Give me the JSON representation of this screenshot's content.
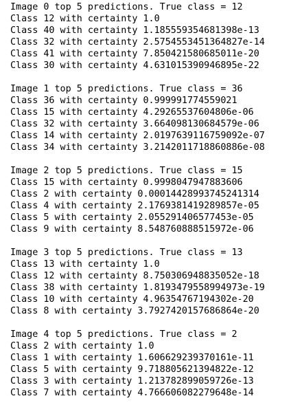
{
  "blocks": [
    {
      "header": "Image 0 top 5 predictions. True class = 12",
      "lines": [
        "Class 12 with certainty 1.0",
        "Class 40 with certainty 1.185559354681398e-13",
        "Class 32 with certainty 2.5754553451364827e-14",
        "Class 41 with certainty 7.850421580685011e-20",
        "Class 30 with certainty 4.631015390946895e-22"
      ]
    },
    {
      "header": "Image 1 top 5 predictions. True class = 36",
      "lines": [
        "Class 36 with certainty 0.999991774559021",
        "Class 15 with certainty 4.29265537604806e-06",
        "Class 32 with certainty 3.664098130684579e-06",
        "Class 14 with certainty 2.0197639116759092e-07",
        "Class 34 with certainty 3.2142011718860886e-08"
      ]
    },
    {
      "header": "Image 2 top 5 predictions. True class = 15",
      "lines": [
        "Class 15 with certainty 0.9998047947883606",
        "Class 2 with certainty 0.00014428993745241314",
        "Class 4 with certainty 2.1769381419289857e-05",
        "Class 5 with certainty 2.055291406577453e-05",
        "Class 9 with certainty 8.548760888515972e-06"
      ]
    },
    {
      "header": "Image 3 top 5 predictions. True class = 13",
      "lines": [
        "Class 13 with certainty 1.0",
        "Class 12 with certainty 8.750306948835052e-18",
        "Class 38 with certainty 1.8193479558994973e-19",
        "Class 10 with certainty 4.96354767194302e-20",
        "Class 8 with certainty 3.7927420157686864e-20"
      ]
    },
    {
      "header": "Image 4 top 5 predictions. True class = 2",
      "lines": [
        "Class 2 with certainty 1.0",
        "Class 1 with certainty 1.606629239370161e-11",
        "Class 5 with certainty 9.718805621394822e-12",
        "Class 3 with certainty 1.213782899059726e-13",
        "Class 7 with certainty 4.766606082279648e-14"
      ]
    }
  ]
}
